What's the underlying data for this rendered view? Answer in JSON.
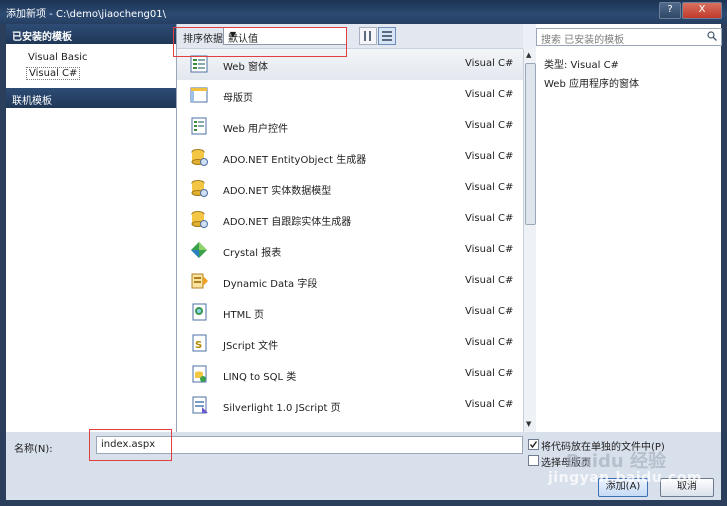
{
  "window": {
    "title": "添加新项 - C:\\demo\\jiaocheng01\\",
    "help_label": "?",
    "close_label": "X"
  },
  "left": {
    "installed_header": "已安装的模板",
    "items": [
      "Visual Basic",
      "Visual C#"
    ],
    "online_header": "联机模板"
  },
  "toolbar": {
    "sort_label": "排序依据:",
    "sort_value": "默认值"
  },
  "templates": [
    {
      "name": "Web 窗体",
      "lang": "Visual C#",
      "icon": "web-form-icon"
    },
    {
      "name": "母版页",
      "lang": "Visual C#",
      "icon": "master-page-icon"
    },
    {
      "name": "Web 用户控件",
      "lang": "Visual C#",
      "icon": "user-control-icon"
    },
    {
      "name": "ADO.NET EntityObject 生成器",
      "lang": "Visual C#",
      "icon": "ado-generator-icon"
    },
    {
      "name": "ADO.NET 实体数据模型",
      "lang": "Visual C#",
      "icon": "ado-model-icon"
    },
    {
      "name": "ADO.NET 自跟踪实体生成器",
      "lang": "Visual C#",
      "icon": "ado-tracking-icon"
    },
    {
      "name": "Crystal 报表",
      "lang": "Visual C#",
      "icon": "crystal-report-icon"
    },
    {
      "name": "Dynamic Data 字段",
      "lang": "Visual C#",
      "icon": "dynamic-data-icon"
    },
    {
      "name": "HTML 页",
      "lang": "Visual C#",
      "icon": "html-page-icon"
    },
    {
      "name": "JScript 文件",
      "lang": "Visual C#",
      "icon": "jscript-file-icon"
    },
    {
      "name": "LINQ to SQL 类",
      "lang": "Visual C#",
      "icon": "linq-to-sql-icon"
    },
    {
      "name": "Silverlight 1.0 JScript 页",
      "lang": "Visual C#",
      "icon": "silverlight-page-icon"
    }
  ],
  "right": {
    "search_placeholder": "搜索 已安装的模板",
    "type_label": "类型:  Visual C#",
    "description": "Web 应用程序的窗体"
  },
  "bottom": {
    "name_label": "名称(N):",
    "name_value": "index.aspx",
    "chk1_label": "将代码放在单独的文件中(P)",
    "chk2_label": "选择母版页",
    "add_label": "添加(A)",
    "cancel_label": "取消"
  },
  "watermark": {
    "text1": "Baidu 经验",
    "text2": "jingyan.baidu.com"
  }
}
